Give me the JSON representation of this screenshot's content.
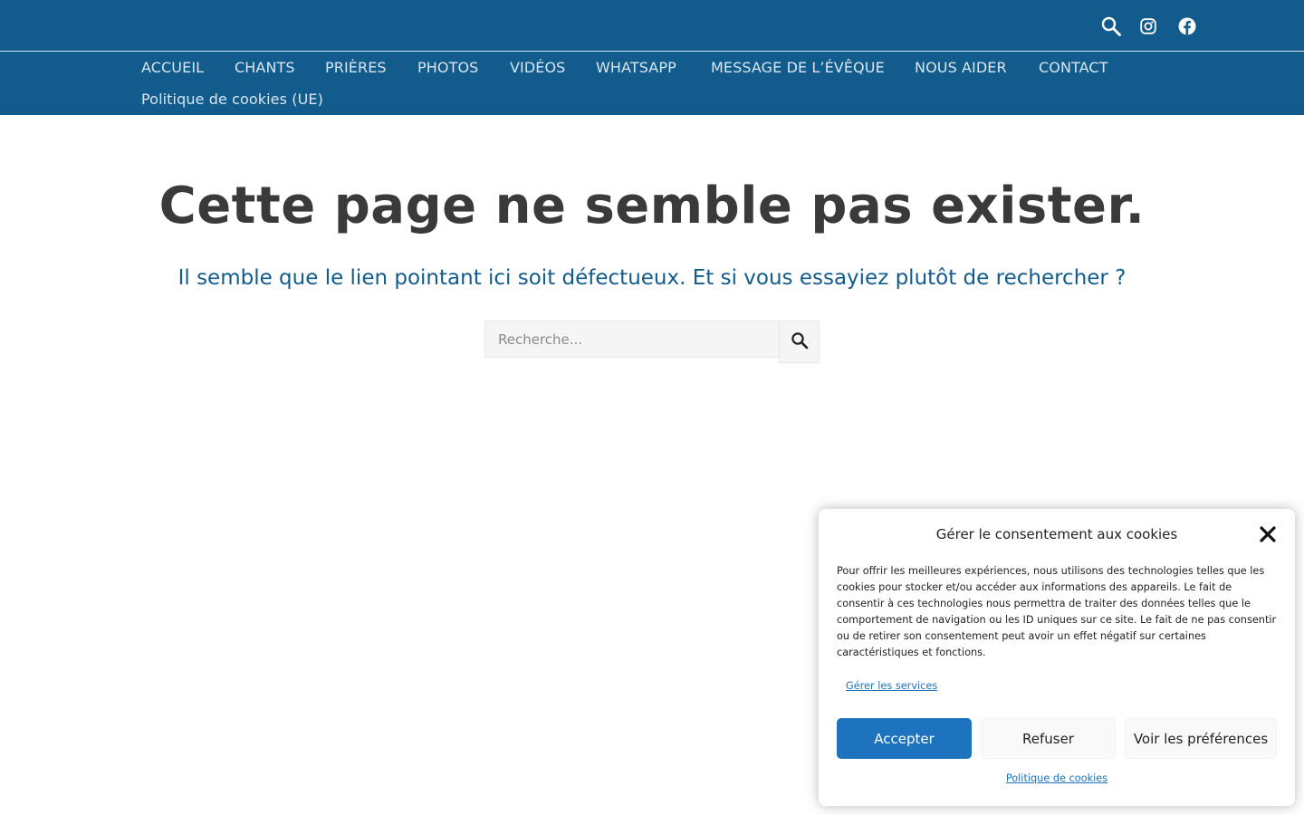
{
  "header": {
    "icons": [
      "search-icon",
      "instagram-icon",
      "facebook-icon"
    ]
  },
  "nav": {
    "items": [
      "ACCUEIL",
      "CHANTS",
      "PRIÈRES",
      "PHOTOS",
      "VIDÉOS",
      "WHATSAPP",
      "MESSAGE DE L’ÉVÊQUE",
      "NOUS AIDER",
      "CONTACT",
      "Politique de cookies (UE)"
    ]
  },
  "main": {
    "title": "Cette page ne semble pas exister.",
    "subtitle": "Il semble que le lien pointant ici soit défectueux. Et si vous essayiez plutôt de rechercher ?",
    "search": {
      "placeholder": "Recherche...",
      "value": ""
    }
  },
  "cookie": {
    "title": "Gérer le consentement aux cookies",
    "body": "Pour offrir les meilleures expériences, nous utilisons des technologies telles que les cookies pour stocker et/ou accéder aux informations des appareils. Le fait de consentir à ces technologies nous permettra de traiter des données telles que le comportement de navigation ou les ID uniques sur ce site. Le fait de ne pas consentir ou de retirer son consentement peut avoir un effet négatif sur certaines caractéristiques et fonctions.",
    "manage_services": "Gérer les services",
    "accept": "Accepter",
    "refuse": "Refuser",
    "preferences": "Voir les préférences",
    "policy_link": "Politique de cookies"
  },
  "colors": {
    "header_bg": "#115b8d",
    "nav_text": "#d9e6f0",
    "accent": "#1e73be",
    "title_text": "#3a3a3a"
  }
}
